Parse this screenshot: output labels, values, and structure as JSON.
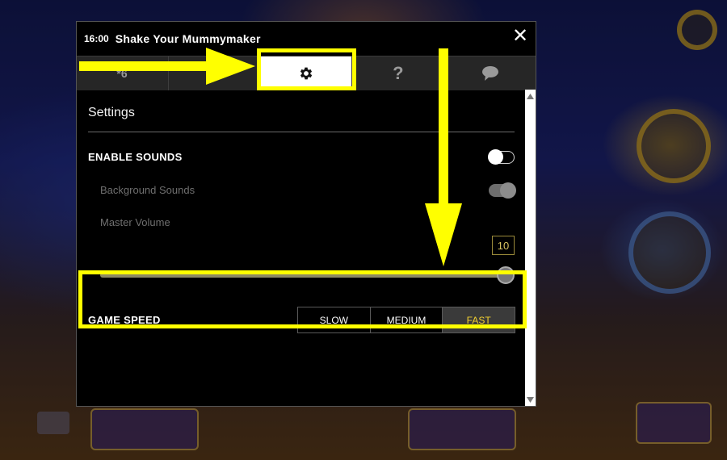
{
  "dialog": {
    "clock": "16:00",
    "title": "Shake Your Mummymaker",
    "close_label": "✕"
  },
  "tabs": [
    {
      "name": "paytable",
      "icon": "paytable-icon",
      "active": false
    },
    {
      "name": "info",
      "icon": "info-icon",
      "active": false
    },
    {
      "name": "settings",
      "icon": "gear-icon",
      "active": true
    },
    {
      "name": "help",
      "icon": "question-icon",
      "label": "?",
      "active": false
    },
    {
      "name": "chat",
      "icon": "chat-bubble-icon",
      "active": false
    }
  ],
  "settings": {
    "title": "Settings",
    "enable_sounds": {
      "label": "ENABLE SOUNDS",
      "on": false
    },
    "background_sounds": {
      "label": "Background Sounds",
      "on": true
    },
    "master_volume": {
      "label": "Master Volume",
      "value": "10",
      "level": 1.0
    },
    "game_speed": {
      "label": "GAME SPEED",
      "options": [
        "SLOW",
        "MEDIUM",
        "FAST"
      ],
      "selected": "FAST"
    }
  },
  "annotations": {
    "color": "#ffff00",
    "description_targets": [
      "settings-tab",
      "game-speed-row"
    ]
  },
  "colors": {
    "accent_selected": "#f3d130",
    "highlight": "#ffff00"
  }
}
